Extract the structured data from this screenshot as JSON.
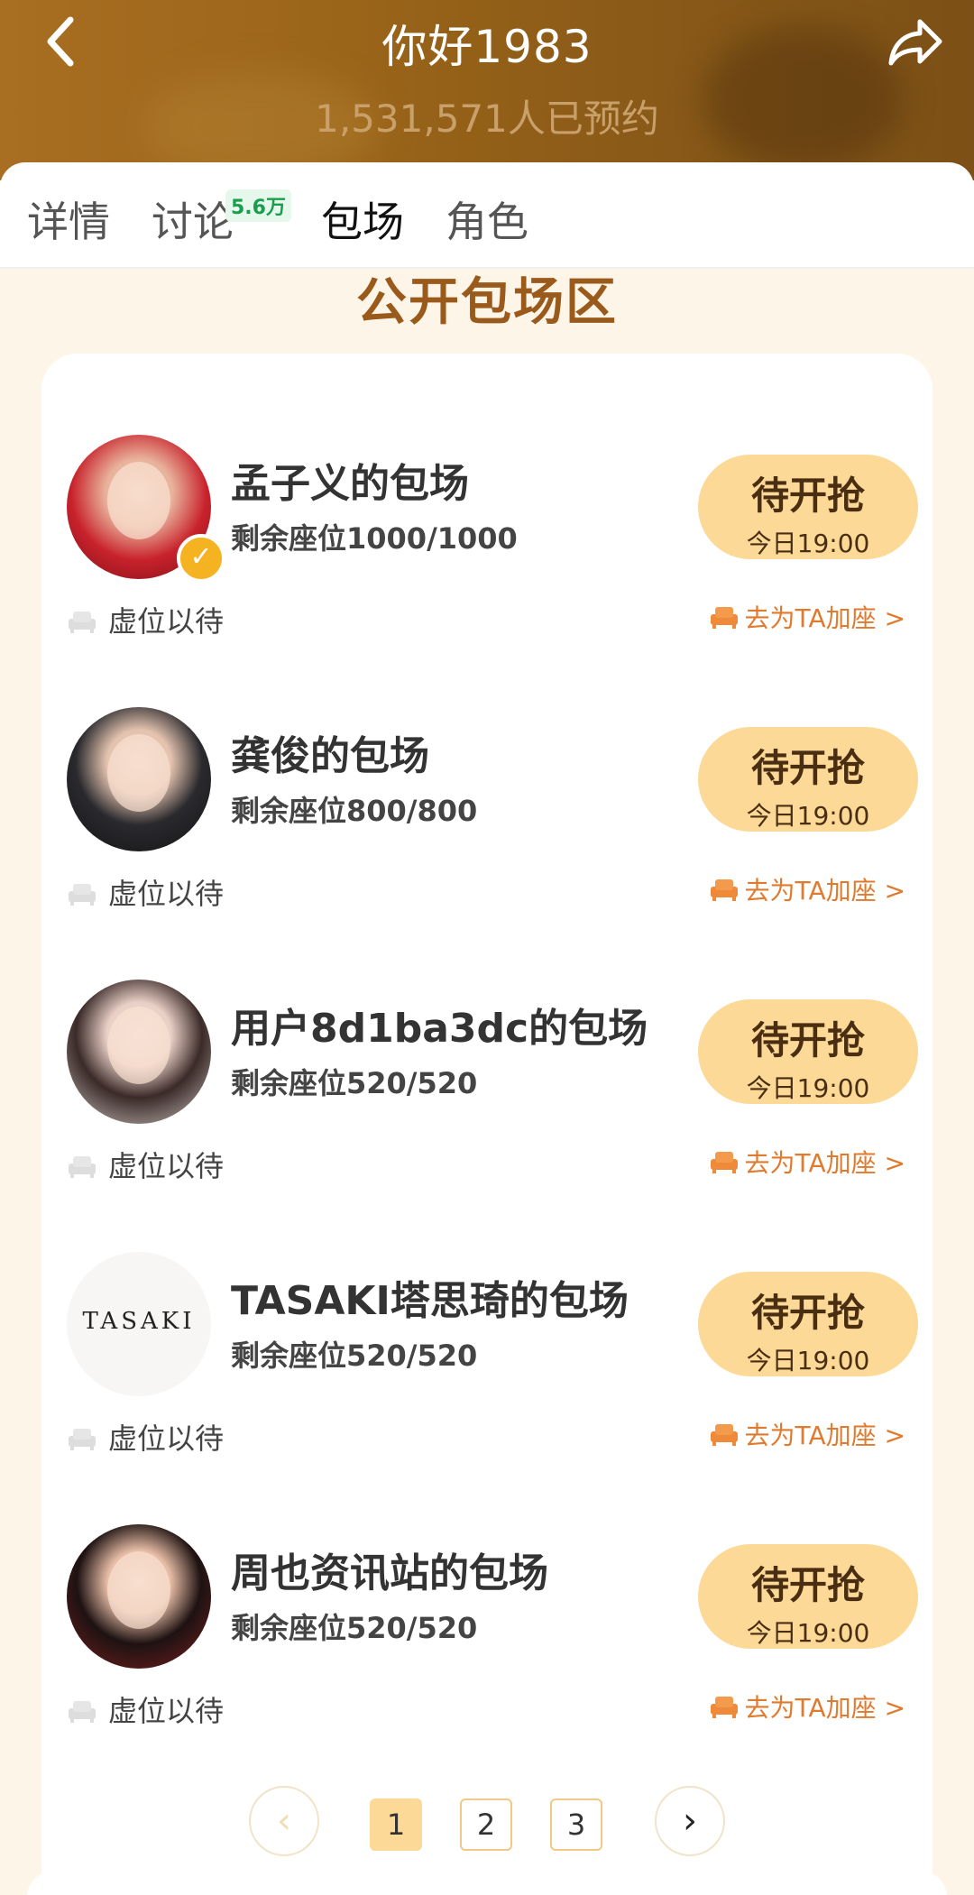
{
  "header": {
    "title": "你好1983",
    "subtitle": "1,531,571人已预约"
  },
  "tabs": [
    {
      "label": "详情",
      "active": false
    },
    {
      "label": "讨论",
      "active": false,
      "badge": "5.6万"
    },
    {
      "label": "包场",
      "active": true
    },
    {
      "label": "角色",
      "active": false
    }
  ],
  "section_title": "公开包场区",
  "rows": [
    {
      "title": "孟子义的包场",
      "seats": "剩余座位1000/1000",
      "button_main": "待开抢",
      "button_sub": "今日19:00",
      "status": "虚位以待",
      "action": "去为TA加座 >",
      "verified": true
    },
    {
      "title": "龚俊的包场",
      "seats": "剩余座位800/800",
      "button_main": "待开抢",
      "button_sub": "今日19:00",
      "status": "虚位以待",
      "action": "去为TA加座 >"
    },
    {
      "title": "用户8d1ba3dc的包场",
      "seats": "剩余座位520/520",
      "button_main": "待开抢",
      "button_sub": "今日19:00",
      "status": "虚位以待",
      "action": "去为TA加座 >"
    },
    {
      "title": "TASAKI塔思琦的包场",
      "seats": "剩余座位520/520",
      "button_main": "待开抢",
      "button_sub": "今日19:00",
      "status": "虚位以待",
      "action": "去为TA加座 >",
      "logo_text": "TASAKI"
    },
    {
      "title": "周也资讯站的包场",
      "seats": "剩余座位520/520",
      "button_main": "待开抢",
      "button_sub": "今日19:00",
      "status": "虚位以待",
      "action": "去为TA加座 >"
    }
  ],
  "pagination": {
    "pages": [
      "1",
      "2",
      "3"
    ],
    "current": "1"
  },
  "colors": {
    "accent": "#fcd997",
    "section_title": "#9a5a1c",
    "link": "#e07a2e",
    "badge_green": "#1a9d4c"
  },
  "icons": {
    "back": "chevron-left-icon",
    "share": "share-arrow-icon",
    "seat": "seat-icon",
    "verified": "verified-badge-icon",
    "prev": "chevron-left-icon",
    "next": "chevron-right-icon"
  }
}
